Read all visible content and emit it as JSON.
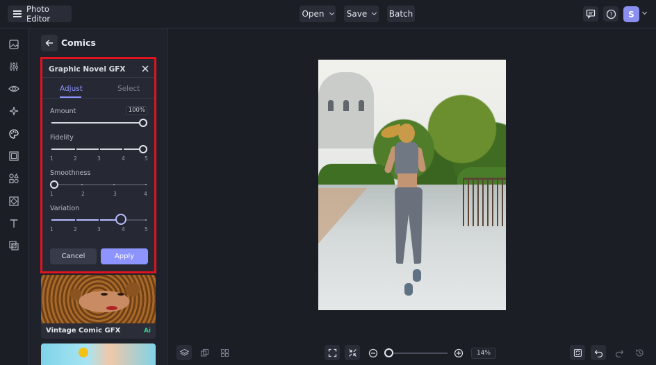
{
  "app": {
    "title": "Photo Editor"
  },
  "toolbar": {
    "open_label": "Open",
    "save_label": "Save",
    "batch_label": "Batch",
    "avatar_initial": "S"
  },
  "panel": {
    "title": "Comics"
  },
  "gfx": {
    "title": "Graphic Novel GFX",
    "tabs": [
      "Adjust",
      "Select"
    ],
    "active_tab": "Adjust",
    "amount": {
      "label": "Amount",
      "value_text": "100%",
      "value": 100
    },
    "fidelity": {
      "label": "Fidelity",
      "ticks": [
        "1",
        "2",
        "3",
        "4",
        "5"
      ],
      "value": 5
    },
    "smoothness": {
      "label": "Smoothness",
      "ticks": [
        "1",
        "2",
        "3",
        "4"
      ],
      "value": 1
    },
    "variation": {
      "label": "Variation",
      "ticks": [
        "1",
        "2",
        "3",
        "4",
        "5"
      ],
      "value": 4
    },
    "cancel_label": "Cancel",
    "apply_label": "Apply"
  },
  "presets": [
    {
      "label": "Vintage Comic GFX",
      "badge": "Ai"
    }
  ],
  "zoom": {
    "value_text": "14%",
    "level": 0.14
  },
  "colors": {
    "accent": "#8d94ff",
    "highlight_border": "#e0141e",
    "ai_badge": "#39d08c"
  },
  "icons": {
    "rail": [
      "image-icon",
      "sliders-icon",
      "eye-icon",
      "magic-icon",
      "palette-icon",
      "frame-icon",
      "shapes-icon",
      "texture-icon",
      "text-icon",
      "overlay-icon"
    ],
    "top_right": [
      "comment-icon",
      "help-icon"
    ],
    "bottom_left": [
      "layers-icon",
      "duplicate-icon",
      "grid-icon"
    ],
    "bottom_center": [
      "fit-screen-icon",
      "actual-size-icon",
      "zoom-out-icon",
      "zoom-in-icon"
    ],
    "bottom_right": [
      "replace-icon",
      "undo-icon",
      "redo-icon",
      "history-icon"
    ]
  }
}
